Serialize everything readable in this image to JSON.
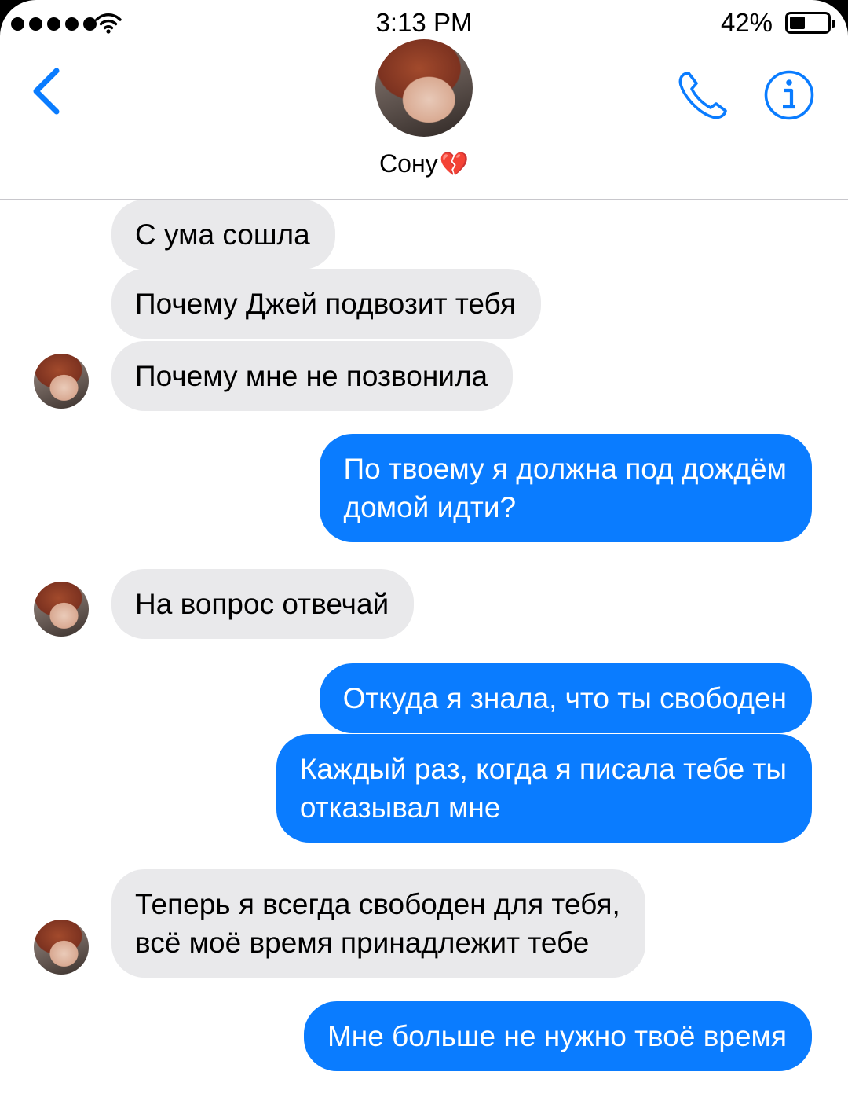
{
  "status_bar": {
    "time": "3:13 PM",
    "battery_percent": "42%",
    "battery_level": 0.42,
    "signal_bars": 5,
    "icons": [
      "signal-dots-icon",
      "wifi-icon",
      "battery-icon"
    ]
  },
  "header": {
    "contact_name": "Сону",
    "contact_emoji": "💔",
    "icons": [
      "back-chevron-icon",
      "phone-icon",
      "info-icon"
    ],
    "accent_color": "#0a7cff"
  },
  "colors": {
    "incoming_bubble": "#e9e9eb",
    "outgoing_bubble": "#0a7cff",
    "outgoing_text": "#ffffff"
  },
  "messages": [
    {
      "direction": "incoming",
      "text": "С ума сошла"
    },
    {
      "direction": "incoming",
      "text": "Почему Джей подвозит тебя"
    },
    {
      "direction": "incoming",
      "text": "Почему мне не позвонила"
    },
    {
      "direction": "outgoing",
      "text": "По твоему я должна под дождём\nдомой идти?"
    },
    {
      "direction": "incoming",
      "text": "На вопрос отвечай"
    },
    {
      "direction": "outgoing",
      "text": "Откуда я знала, что ты свободен"
    },
    {
      "direction": "outgoing",
      "text": "Каждый раз, когда я писала тебе ты\nотказывал мне"
    },
    {
      "direction": "incoming",
      "text": "Теперь я всегда свободен для тебя,\nвсё моё время принадлежит тебе"
    },
    {
      "direction": "outgoing",
      "text": "Мне больше не нужно твоё время"
    }
  ]
}
